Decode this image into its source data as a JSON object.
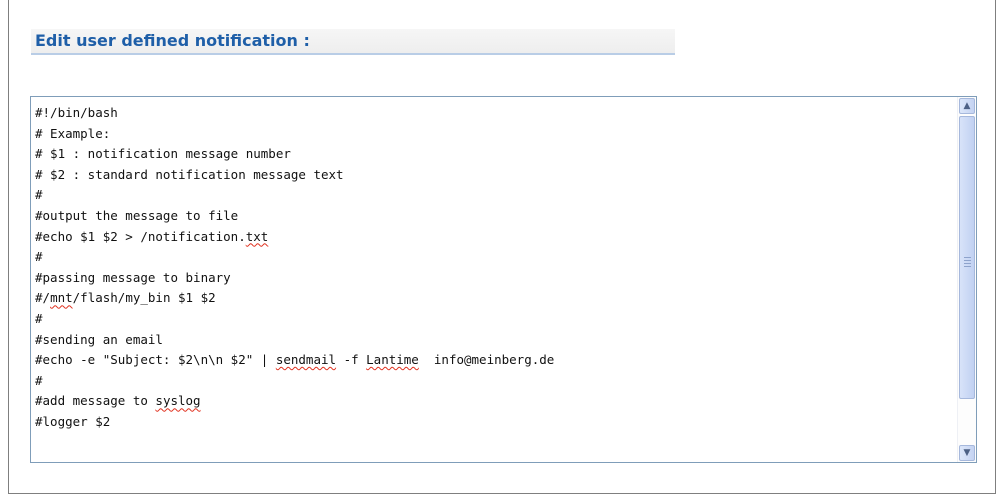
{
  "section": {
    "title": "Edit user defined notification :"
  },
  "editor": {
    "lines": [
      "#!/bin/bash",
      "# Example:",
      "# $1 : notification message number",
      "# $2 : standard notification message text",
      "#",
      "#output the message to file",
      "#echo $1 $2 > /notification.txt",
      "#",
      "#passing message to binary",
      "#/mnt/flash/my_bin $1 $2",
      "#",
      "#sending an email",
      "#echo -e \"Subject: $2\\n\\n $2\" | sendmail -f Lantime  info@meinberg.de",
      "#",
      "#add message to syslog",
      "#logger $2"
    ],
    "scrollbar": {
      "up_icon": "chevron-up-icon",
      "down_icon": "chevron-down-icon",
      "thumb_fraction": 0.86,
      "thumb_position": 0
    }
  },
  "colors": {
    "title": "#1f5fa8",
    "header_underline": "#b9cde6",
    "textarea_border": "#7f9db9",
    "scrollbar_accent": "#c4d3f2",
    "spellcheck_underline": "#e0301e"
  }
}
